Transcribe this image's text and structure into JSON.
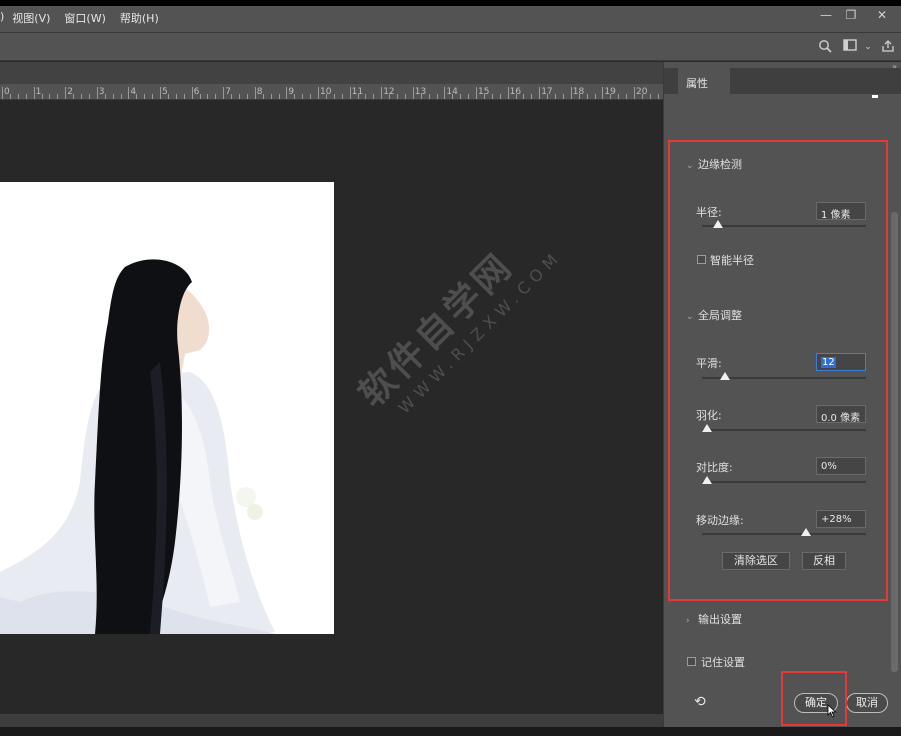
{
  "menu": {
    "items": [
      ")",
      "视图(V)",
      "窗口(W)",
      "帮助(H)"
    ]
  },
  "window_controls": {
    "minimize_icon": "minimize-icon",
    "restore_icon": "restore-icon",
    "close_icon": "close-icon"
  },
  "toolbar_icons": [
    "search-icon",
    "workspace-icon",
    "chevron-down-icon",
    "share-icon"
  ],
  "ruler": {
    "labels": [
      "0",
      "1",
      "2",
      "3",
      "4",
      "5",
      "6",
      "7",
      "8",
      "9",
      "10",
      "11",
      "12",
      "13",
      "14",
      "15",
      "16",
      "17",
      "18",
      "19",
      "20"
    ]
  },
  "watermark": {
    "text_cn": "软件自学网",
    "text_en": "WWW.RJZXW.COM"
  },
  "panel": {
    "tab": "属性",
    "edge_detection": {
      "title": "边缘检测",
      "radius_label": "半径:",
      "radius_value": "1 像素",
      "radius_level": 0.07,
      "smart_radius_label": "智能半径"
    },
    "global_refine": {
      "title": "全局调整",
      "smooth_label": "平滑:",
      "smooth_value": "12",
      "smooth_level": 0.12,
      "feather_label": "羽化:",
      "feather_value": "0.0 像素",
      "feather_level": 0.0,
      "contrast_label": "对比度:",
      "contrast_value": "0%",
      "contrast_level": 0.0,
      "shift_edge_label": "移动边缘:",
      "shift_edge_value": "+28%",
      "shift_edge_level": 0.64,
      "clear_selection_button": "清除选区",
      "invert_button": "反相"
    },
    "output_settings": {
      "title": "输出设置"
    },
    "remember_settings_label": "记住设置",
    "ok_button": "确定",
    "cancel_button": "取消"
  },
  "colors": {
    "highlight_red": "#e53935",
    "selection_blue": "#2f6fd1"
  }
}
